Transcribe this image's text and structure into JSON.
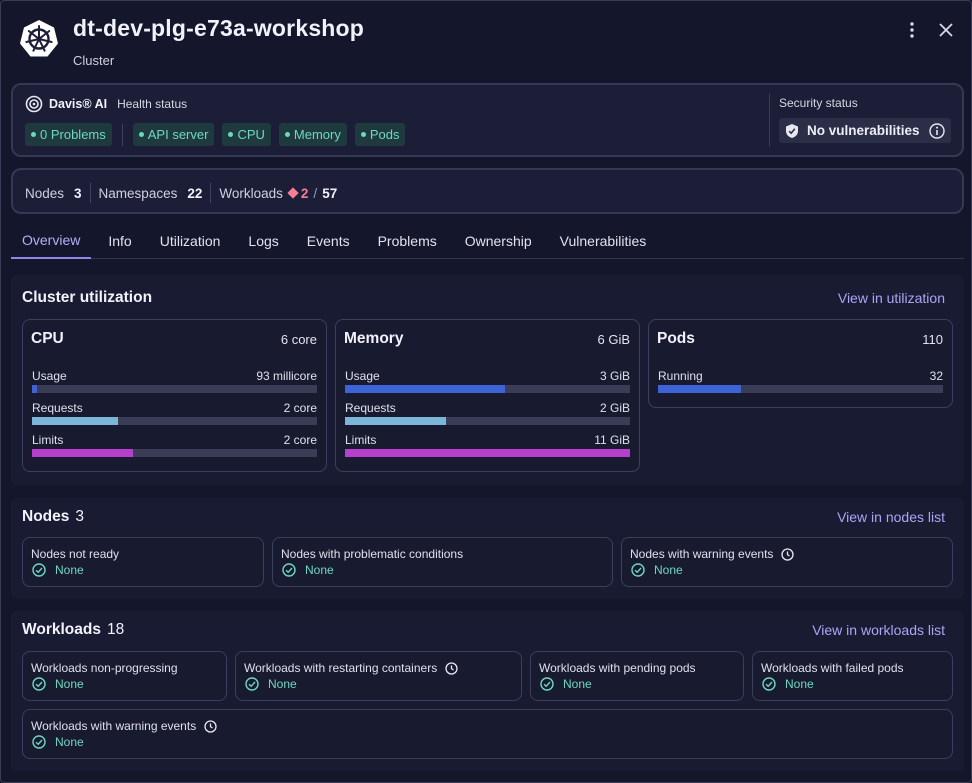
{
  "header": {
    "title": "dt-dev-plg-e73a-workshop",
    "subtitle": "Cluster"
  },
  "health": {
    "davis_name": "Davis® AI",
    "health_label": "Health status",
    "problems_chip": "0 Problems",
    "components": [
      "API server",
      "CPU",
      "Memory",
      "Pods"
    ],
    "security_label": "Security status",
    "security_value": "No vulnerabilities"
  },
  "counts": {
    "nodes_label": "Nodes",
    "nodes_value": "3",
    "namespaces_label": "Namespaces",
    "namespaces_value": "22",
    "workloads_label": "Workloads",
    "workloads_warning": "2",
    "workloads_total": "57"
  },
  "tabs": [
    "Overview",
    "Info",
    "Utilization",
    "Logs",
    "Events",
    "Problems",
    "Ownership",
    "Vulnerabilities"
  ],
  "utilization": {
    "title": "Cluster utilization",
    "link": "View in utilization",
    "metrics": [
      {
        "name": "CPU",
        "total": "6 core",
        "rows": [
          {
            "label": "Usage",
            "value": "93 millicore",
            "fraction": 0.016,
            "color": "#3e63d6"
          },
          {
            "label": "Requests",
            "value": "2 core",
            "fraction": 0.3,
            "color": "#7bb6d8"
          },
          {
            "label": "Limits",
            "value": "2 core",
            "fraction": 0.355,
            "color": "#b83fcb"
          }
        ]
      },
      {
        "name": "Memory",
        "total": "6 GiB",
        "rows": [
          {
            "label": "Usage",
            "value": "3 GiB",
            "fraction": 0.56,
            "color": "#3e63d6"
          },
          {
            "label": "Requests",
            "value": "2 GiB",
            "fraction": 0.355,
            "color": "#7bb6d8"
          },
          {
            "label": "Limits",
            "value": "11 GiB",
            "fraction": 1.0,
            "color": "#b83fcb"
          }
        ]
      },
      {
        "name": "Pods",
        "total": "110",
        "rows": [
          {
            "label": "Running",
            "value": "32",
            "fraction": 0.29,
            "color": "#3e63d6"
          }
        ]
      }
    ]
  },
  "nodes": {
    "title": "Nodes",
    "count": "3",
    "link": "View in nodes list",
    "tiles": [
      {
        "label": "Nodes not ready",
        "value": "None"
      },
      {
        "label": "Nodes with problematic conditions",
        "value": "None"
      },
      {
        "label": "Nodes with warning events",
        "value": "None"
      }
    ]
  },
  "workloads": {
    "title": "Workloads",
    "count": "18",
    "link": "View in workloads list",
    "tiles": [
      {
        "label": "Workloads non-progressing",
        "value": "None"
      },
      {
        "label": "Workloads with restarting containers",
        "value": "None"
      },
      {
        "label": "Workloads with pending pods",
        "value": "None"
      },
      {
        "label": "Workloads with failed pods",
        "value": "None"
      },
      {
        "label": "Workloads with warning events",
        "value": "None"
      }
    ]
  }
}
